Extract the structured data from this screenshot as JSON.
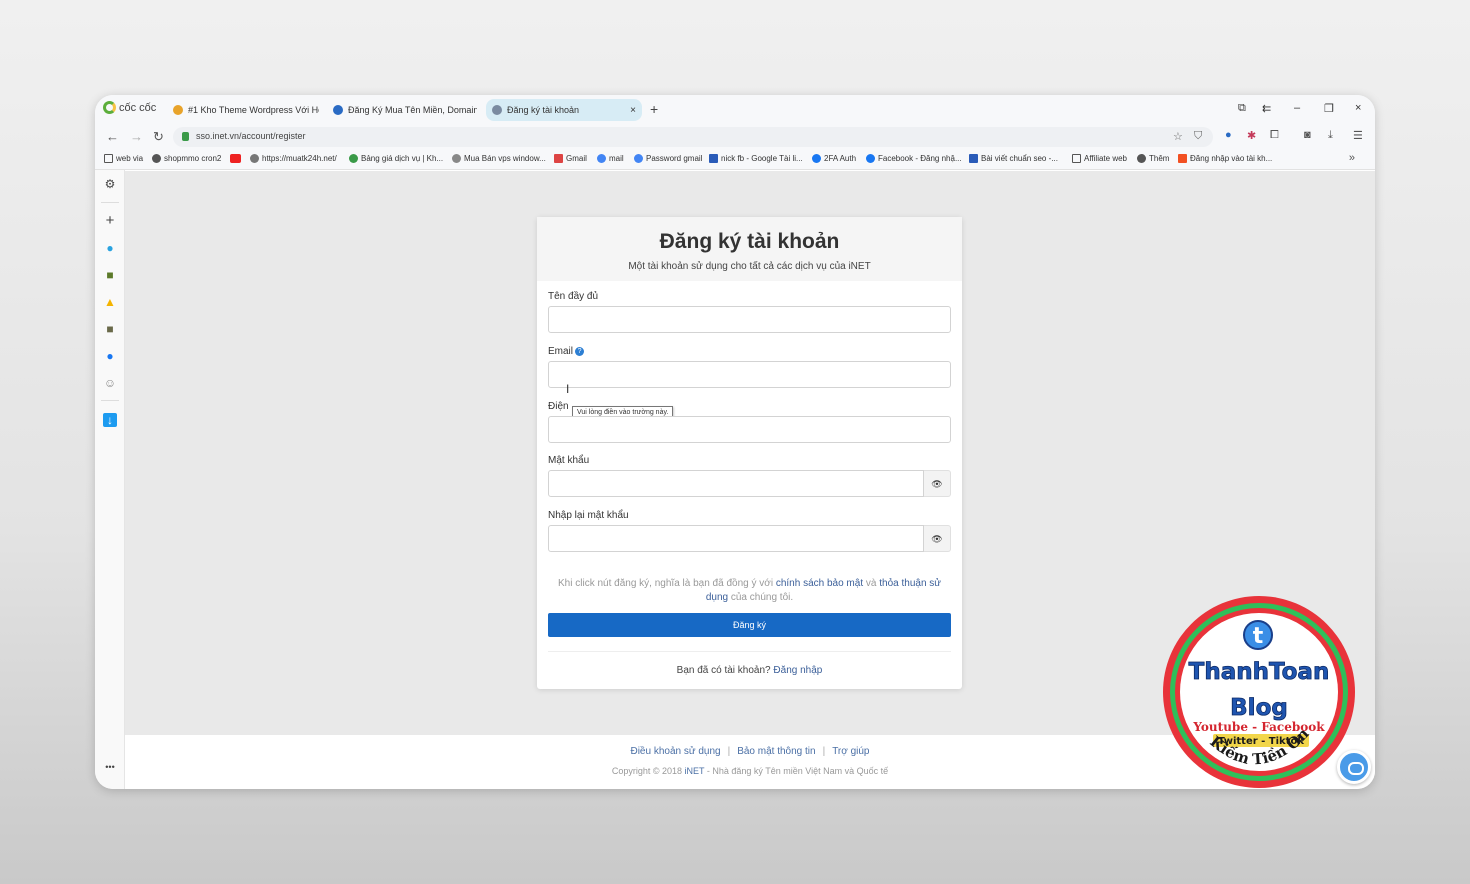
{
  "browser": {
    "brand": "cốc cốc",
    "tabs": [
      {
        "title": "#1 Kho Theme Wordpress Với Họ",
        "fav_color": "#e8a32a"
      },
      {
        "title": "Đăng Ký Mua Tên Miền, Domain",
        "fav_color": "#2a6bc4"
      },
      {
        "title": "Đăng ký tài khoản",
        "fav_color": "#7a8aa0",
        "active": true
      }
    ],
    "tab_close": "×",
    "new_tab": "+",
    "window_controls": [
      "⧉",
      "⇇",
      "–",
      "❐",
      "×"
    ],
    "url": "sso.inet.vn/account/register",
    "bookmarks": [
      "web via",
      "shopmmo cron2",
      "https://muatk24h.net/",
      "Bảng giá dịch vụ | Kh...",
      "Mua Bán vps window...",
      "Gmail",
      "mail",
      "Password gmail",
      "nick fb - Google Tài li...",
      "2FA Auth",
      "Facebook - Đăng nhậ...",
      "Bài viết chuẩn seo -...",
      "Affiliate web",
      "Thêm",
      "Đăng nhập vào tài kh..."
    ],
    "bookmarks_more": "»"
  },
  "sidebar": {
    "icons": [
      "gear-icon",
      "plus-icon",
      "telegram-icon",
      "app-icon",
      "google-drive-icon",
      "m-icon",
      "facebook-icon",
      "smiley-icon",
      "download-app-icon"
    ],
    "more": "•••"
  },
  "form": {
    "title": "Đăng ký tài khoản",
    "subtitle": "Một tài khoản sử dụng cho tất cả các dịch vụ của iNET",
    "fields": {
      "fullname_label": "Tên đầy đủ",
      "email_label": "Email",
      "phone_label": "Điện",
      "password_label": "Mật khẩu",
      "confirm_label": "Nhập lại mật khẩu"
    },
    "tooltip": "Vui lòng điền vào trường này.",
    "terms_prefix": "Khi click nút đăng ký, nghĩa là bạn đã đồng ý với ",
    "terms_privacy": "chính sách bảo mật",
    "terms_and": " và ",
    "terms_tos": "thỏa thuận sử dụng",
    "terms_suffix": " của chúng tôi.",
    "submit": "Đăng ký",
    "login_prompt": "Bạn đã có tài khoản? ",
    "login_link": "Đăng nhập"
  },
  "footer": {
    "links": [
      "Điều khoản sử dụng",
      "Bảo mật thông tin",
      "Trợ giúp"
    ],
    "copyright_prefix": "Copyright © 2018 ",
    "copyright_brand": "iNET",
    "copyright_suffix": " - Nhà đăng ký Tên miền Việt Nam và Quốc tế"
  },
  "watermark": {
    "name": "ThanhToan",
    "blog": "Blog",
    "line1": "Youtube - Facebook",
    "line2": "Twitter - Tiktok",
    "arc": "Kiếm Tiền Online"
  }
}
